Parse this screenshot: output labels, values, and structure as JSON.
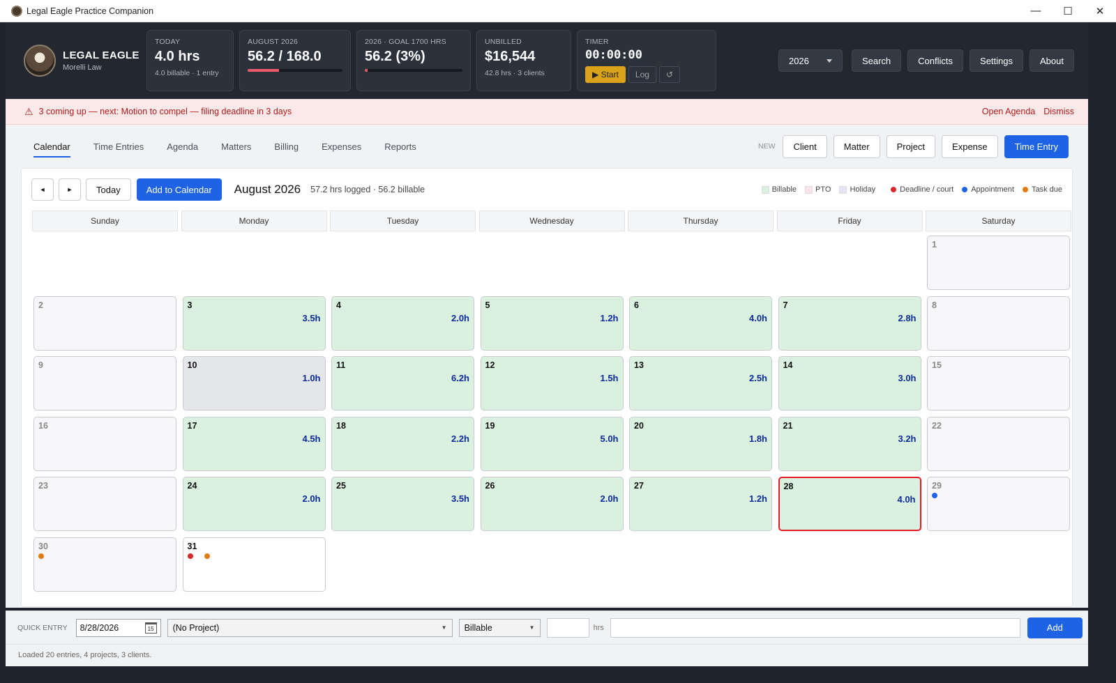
{
  "window": {
    "title": "Legal Eagle Practice Companion",
    "controls": [
      "—",
      "☐",
      "✕"
    ]
  },
  "brand": {
    "name": "LEGAL EAGLE",
    "firm": "Morelli Law"
  },
  "stats": {
    "today": {
      "label": "TODAY",
      "value": "4.0 hrs",
      "sub": "4.0 billable · 1 entry"
    },
    "month": {
      "label": "AUGUST 2026",
      "value": "56.2 / 168.0",
      "progress": 0.33
    },
    "goal": {
      "label": "2026 · GOAL 1700 HRS",
      "value": "56.2  (3%)",
      "progress": 0.03
    },
    "unbilled": {
      "label": "UNBILLED",
      "value": "$16,544",
      "sub": "42.8 hrs · 3 clients"
    },
    "timer": {
      "label": "TIMER",
      "value": "00:00:00",
      "start": "▶ Start",
      "log": "Log",
      "reset": "↺"
    }
  },
  "header_buttons": {
    "year": "2026",
    "search": "Search",
    "conflicts": "Conflicts",
    "settings": "Settings",
    "about": "About"
  },
  "alert": {
    "icon": "⚠",
    "text": "3 coming up — next: Motion to compel — filing deadline in 3 days",
    "open": "Open Agenda",
    "dismiss": "Dismiss"
  },
  "tabs": [
    "Calendar",
    "Time Entries",
    "Agenda",
    "Matters",
    "Billing",
    "Expenses",
    "Reports"
  ],
  "new": {
    "label": "NEW",
    "client": "Client",
    "matter": "Matter",
    "project": "Project",
    "expense": "Expense",
    "time_entry": "Time Entry"
  },
  "calendar": {
    "prev": "◄",
    "next": "►",
    "today": "Today",
    "add": "Add to Calendar",
    "month": "August 2026",
    "summary": "57.2 hrs logged · 56.2 billable",
    "legend": {
      "billable": "Billable",
      "pto": "PTO",
      "holiday": "Holiday",
      "deadline": "Deadline / court",
      "appointment": "Appointment",
      "task": "Task due"
    },
    "colors": {
      "billable": "#dbf1e0",
      "pto": "#fde3ea",
      "holiday": "#e6e3f3",
      "deadline": "#d62a2a",
      "appointment": "#1e63e6",
      "task": "#e07b12"
    },
    "days_of_week": [
      "Sunday",
      "Monday",
      "Tuesday",
      "Wednesday",
      "Thursday",
      "Friday",
      "Saturday"
    ],
    "cells": [
      {
        "d": ""
      },
      {
        "d": ""
      },
      {
        "d": ""
      },
      {
        "d": ""
      },
      {
        "d": ""
      },
      {
        "d": ""
      },
      {
        "d": "1",
        "t": "wk"
      },
      {
        "d": "2",
        "t": "wk"
      },
      {
        "d": "3",
        "h": "3.5h",
        "t": "work"
      },
      {
        "d": "4",
        "h": "2.0h",
        "t": "work"
      },
      {
        "d": "5",
        "h": "1.2h",
        "t": "work"
      },
      {
        "d": "6",
        "h": "4.0h",
        "t": "work"
      },
      {
        "d": "7",
        "h": "2.8h",
        "t": "work"
      },
      {
        "d": "8",
        "t": "wk"
      },
      {
        "d": "9",
        "t": "wk"
      },
      {
        "d": "10",
        "h": "1.0h",
        "t": "pto"
      },
      {
        "d": "11",
        "h": "6.2h",
        "t": "work"
      },
      {
        "d": "12",
        "h": "1.5h",
        "t": "work"
      },
      {
        "d": "13",
        "h": "2.5h",
        "t": "work"
      },
      {
        "d": "14",
        "h": "3.0h",
        "t": "work"
      },
      {
        "d": "15",
        "t": "wk"
      },
      {
        "d": "16",
        "t": "wk"
      },
      {
        "d": "17",
        "h": "4.5h",
        "t": "work"
      },
      {
        "d": "18",
        "h": "2.2h",
        "t": "work"
      },
      {
        "d": "19",
        "h": "5.0h",
        "t": "work"
      },
      {
        "d": "20",
        "h": "1.8h",
        "t": "work"
      },
      {
        "d": "21",
        "h": "3.2h",
        "t": "work"
      },
      {
        "d": "22",
        "t": "wk"
      },
      {
        "d": "23",
        "t": "wk"
      },
      {
        "d": "24",
        "h": "2.0h",
        "t": "work"
      },
      {
        "d": "25",
        "h": "3.5h",
        "t": "work"
      },
      {
        "d": "26",
        "h": "2.0h",
        "t": "work"
      },
      {
        "d": "27",
        "h": "1.2h",
        "t": "work"
      },
      {
        "d": "28",
        "h": "4.0h",
        "t": "work sel"
      },
      {
        "d": "29",
        "t": "wk",
        "dots": [
          "appointment"
        ]
      },
      {
        "d": "30",
        "t": "wk",
        "dots": [
          "task"
        ]
      },
      {
        "d": "31",
        "t": "plain",
        "dots": [
          "deadline",
          "task"
        ]
      }
    ]
  },
  "quick_entry": {
    "label": "QUICK ENTRY",
    "date": "8/28/2026",
    "date_icon": "15",
    "project": "(No Project)",
    "type": "Billable",
    "hrs_label": "hrs",
    "add": "Add",
    "caret": "▼"
  },
  "status": "Loaded 20 entries, 4 projects, 3 clients."
}
